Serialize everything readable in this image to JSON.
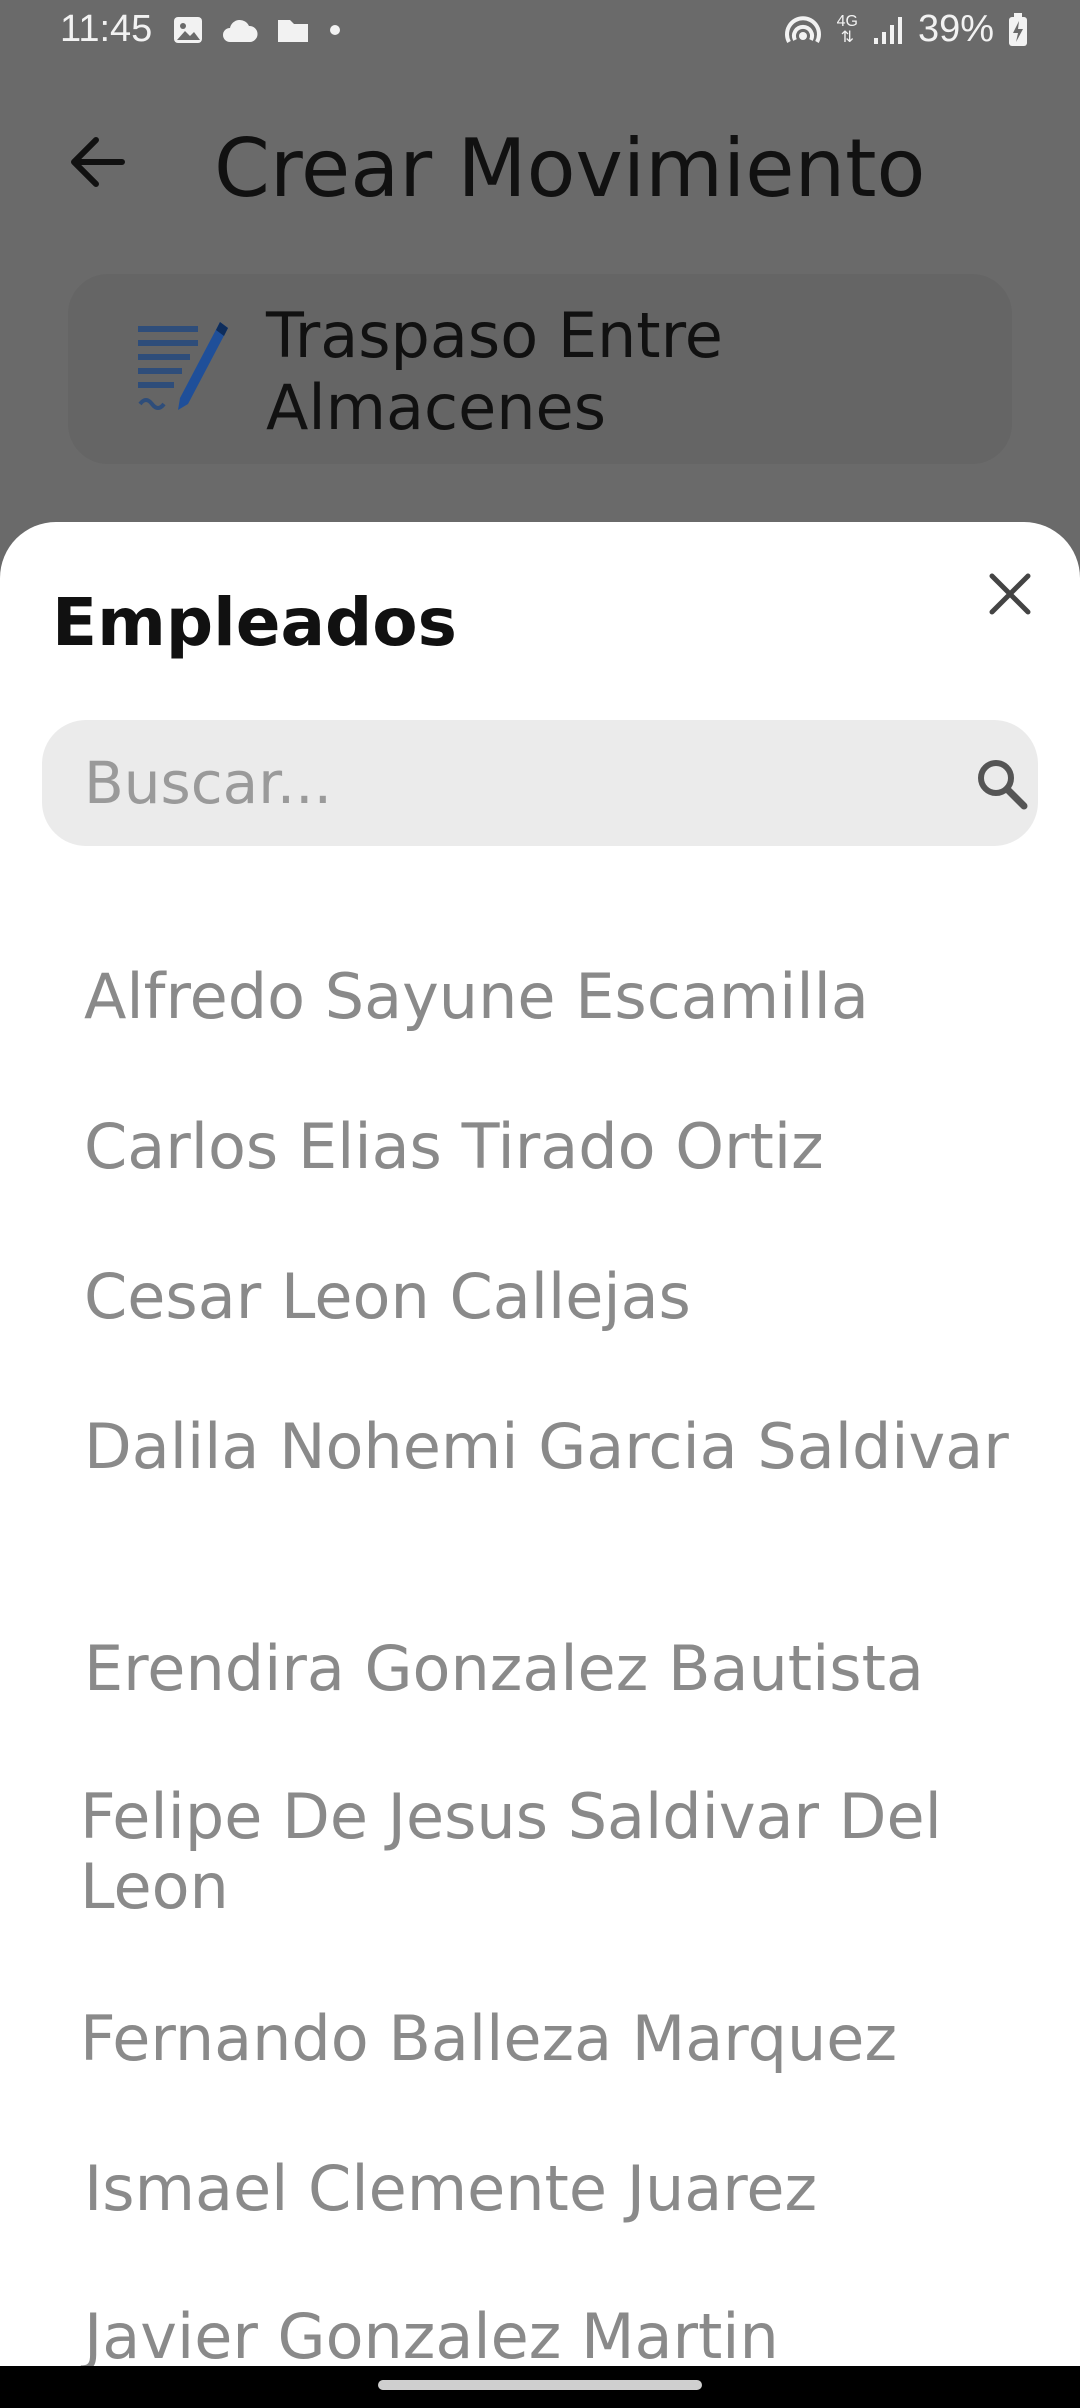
{
  "status_bar": {
    "time": "11:45",
    "network": "4G",
    "battery": "39%",
    "left_icons": [
      "image-icon",
      "cloud-icon",
      "folder-icon",
      "dot-icon"
    ],
    "right_icons": [
      "hotspot-icon",
      "network-icon",
      "signal-icon",
      "battery-charging-icon"
    ]
  },
  "header": {
    "title": "Crear Movimiento",
    "back_icon": "arrow-left-icon"
  },
  "card": {
    "label": "Traspaso Entre Almacenes",
    "icon": "document-pen-icon"
  },
  "sheet": {
    "title": "Empleados",
    "close_icon": "close-icon",
    "search": {
      "placeholder": "Buscar...",
      "icon": "search-icon"
    },
    "employees": [
      "Alfredo Sayune Escamilla",
      "Carlos Elias Tirado Ortiz",
      "Cesar Leon Callejas",
      "Dalila Nohemi Garcia Saldivar",
      "Erendira Gonzalez Bautista",
      "Felipe De Jesus Saldivar Del Leon",
      "Fernando Balleza Marquez",
      "Ismael Clemente Juarez",
      "Javier Gonzalez Martin"
    ]
  }
}
